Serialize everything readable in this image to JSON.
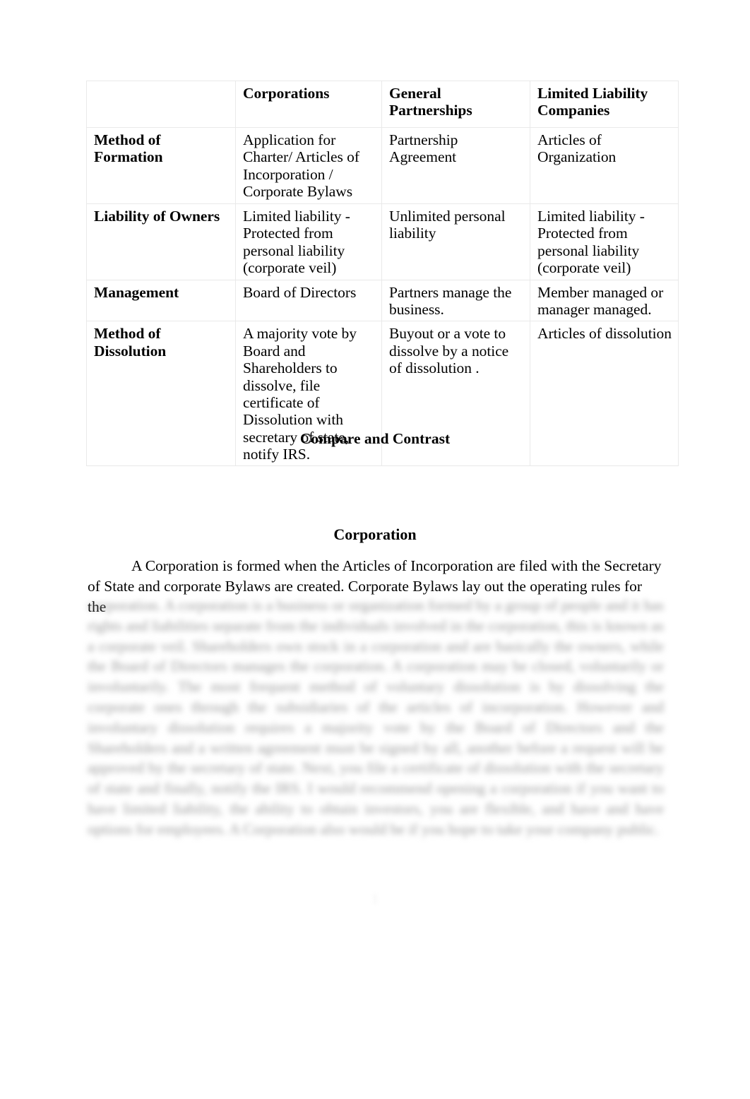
{
  "document": {
    "table": {
      "name": "business-entity-comparison-table",
      "column_headers": [
        "",
        "Corporations",
        "General Partnerships",
        "Limited Liability Companies"
      ],
      "rows": [
        {
          "label": "Method of Formation",
          "corporations": "Application for Charter/ Articles of Incorporation / Corporate Bylaws",
          "general_partnerships": "Partnership Agreement",
          "llc": "Articles of Organization"
        },
        {
          "label": "Liability of Owners",
          "corporations": "Limited liability -Protected from personal liability (corporate veil)",
          "general_partnerships": "Unlimited personal liability",
          "llc": "Limited liability -Protected from personal liability (corporate veil)"
        },
        {
          "label": "Management",
          "corporations": "Board of Directors",
          "general_partnerships": "Partners manage the business.",
          "llc": "Member managed or manager managed."
        },
        {
          "label": "Method of Dissolution",
          "corporations": "A majority vote by Board and Shareholders to dissolve, file certificate of Dissolution with secretary of state, notify IRS.",
          "general_partnerships": "Buyout or a vote to dissolve by a notice of dissolution .",
          "llc": "Articles of dissolution"
        }
      ]
    },
    "caption": "Compare and Contrast",
    "section_heading": "Corporation",
    "paragraph": {
      "visible_text": "A Corporation is formed when the Articles of Incorporation are filed with the Secretary of State and corporate Bylaws are created. Corporate Bylaws lay out the operating rules for the",
      "obscured_lines": [
        "corporation. A corporation is a business or organization formed by a group of people and it has rights and liabilities separate from the individuals involved in the corporation, this is known as a corporate veil. Shareholders own stock in a corporation and are basically the owners, while the",
        "Board of Directors manages the corporation. A corporation may be closed, voluntarily or involuntarily. The most frequent method of voluntary dissolution is by dissolving the corporate ones through the subsidiaries of the articles of incorporation. However and involuntary",
        "dissolution requires a majority vote by the Board of Directors and the Shareholders and a written agreement must be signed by all, another before a request will be approved by the secretary of",
        "state. Next, you file a certificate of dissolution with the secretary of state and finally, notify the",
        "IRS. I would recommend opening a corporation if you want to have limited liability, the ability",
        "to obtain investors, you are flexible, and have and have options for employees. A Corporation",
        "also would be if you hope to take your company public."
      ]
    },
    "page_number": "1"
  }
}
